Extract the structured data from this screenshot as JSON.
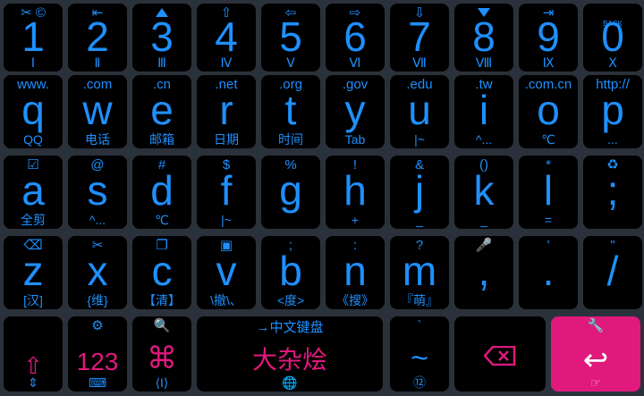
{
  "colors": {
    "accent": "#1e90ff",
    "pink": "#e0197d",
    "key_bg": "#000000",
    "board_bg": "#2b313a"
  },
  "row1": [
    {
      "top": "✂ ©",
      "main": "1",
      "bot": "Ⅰ"
    },
    {
      "top": "⇤",
      "main": "2",
      "bot": "Ⅱ"
    },
    {
      "top": "",
      "main": "3",
      "bot": "Ⅲ"
    },
    {
      "top": "⇧",
      "main": "4",
      "bot": "Ⅳ"
    },
    {
      "top": "⇦",
      "main": "5",
      "bot": "Ⅴ"
    },
    {
      "top": "⇨",
      "main": "6",
      "bot": "Ⅵ"
    },
    {
      "top": "⇩",
      "main": "7",
      "bot": "Ⅶ"
    },
    {
      "top": "",
      "main": "8",
      "bot": "Ⅷ"
    },
    {
      "top": "⇥",
      "main": "9",
      "bot": "Ⅸ"
    },
    {
      "top": "BACK",
      "main": "0",
      "bot": "Ⅹ"
    }
  ],
  "row2": [
    {
      "top": "www.",
      "main": "q",
      "bot": "QQ"
    },
    {
      "top": ".com",
      "main": "w",
      "bot": "电话"
    },
    {
      "top": ".cn",
      "main": "e",
      "bot": "邮箱"
    },
    {
      "top": ".net",
      "main": "r",
      "bot": "日期"
    },
    {
      "top": ".org",
      "main": "t",
      "bot": "时间"
    },
    {
      "top": ".gov",
      "main": "y",
      "bot": "Tab"
    },
    {
      "top": ".edu",
      "main": "u",
      "bot": "|~"
    },
    {
      "top": ".tw",
      "main": "i",
      "bot": "^..."
    },
    {
      "top": ".com.cn",
      "main": "o",
      "bot": "℃"
    },
    {
      "top": "http://",
      "main": "p",
      "bot": "..."
    }
  ],
  "row3": [
    {
      "top": "☑",
      "main": "a",
      "bot": "全剪"
    },
    {
      "top": "@",
      "main": "s",
      "bot": "^..."
    },
    {
      "top": "#",
      "main": "d",
      "bot": "℃"
    },
    {
      "top": "$",
      "main": "f",
      "bot": "|~"
    },
    {
      "top": "%",
      "main": "g",
      "bot": ""
    },
    {
      "top": "!",
      "main": "h",
      "bot": "+"
    },
    {
      "top": "&",
      "main": "j",
      "bot": "_"
    },
    {
      "top": "()",
      "main": "k",
      "bot": "_"
    },
    {
      "top": "*",
      "main": "l",
      "bot": "="
    },
    {
      "top": "♻",
      "main": ";",
      "bot": ""
    }
  ],
  "row4": [
    {
      "top": "⌫",
      "main": "z",
      "bot": "[汉]"
    },
    {
      "top": "✂",
      "main": "x",
      "bot": "{维}"
    },
    {
      "top": "❐",
      "main": "c",
      "bot": "【清】"
    },
    {
      "top": "▣",
      "main": "v",
      "bot": "\\撤\\、"
    },
    {
      "top": ";",
      "main": "b",
      "bot": "<度>"
    },
    {
      "top": ":",
      "main": "n",
      "bot": "《搜》"
    },
    {
      "top": "?",
      "main": "m",
      "bot": "『萌』"
    },
    {
      "top": "🎤",
      "main": ",",
      "bot": ""
    },
    {
      "top": "'",
      "main": ".",
      "bot": ""
    },
    {
      "top": "\"",
      "main": "/",
      "bot": ""
    }
  ],
  "row5": {
    "shift": {
      "main": "⇧",
      "bot": "⇕"
    },
    "numbers": {
      "top": "⚙",
      "main": "123",
      "bot": "⌨"
    },
    "symbols": {
      "top": "🔍",
      "main": "⌘",
      "bot": "⟨I⟩"
    },
    "space": {
      "top": "→中文键盘",
      "main": "大杂烩",
      "bot": "🌐"
    },
    "tilde": {
      "top": "`",
      "main": "~",
      "bot": "⑫"
    },
    "backspace": {
      "icon": "backspace-icon"
    },
    "enter": {
      "top": "🔧",
      "main": "↩",
      "bot": "☞"
    }
  }
}
